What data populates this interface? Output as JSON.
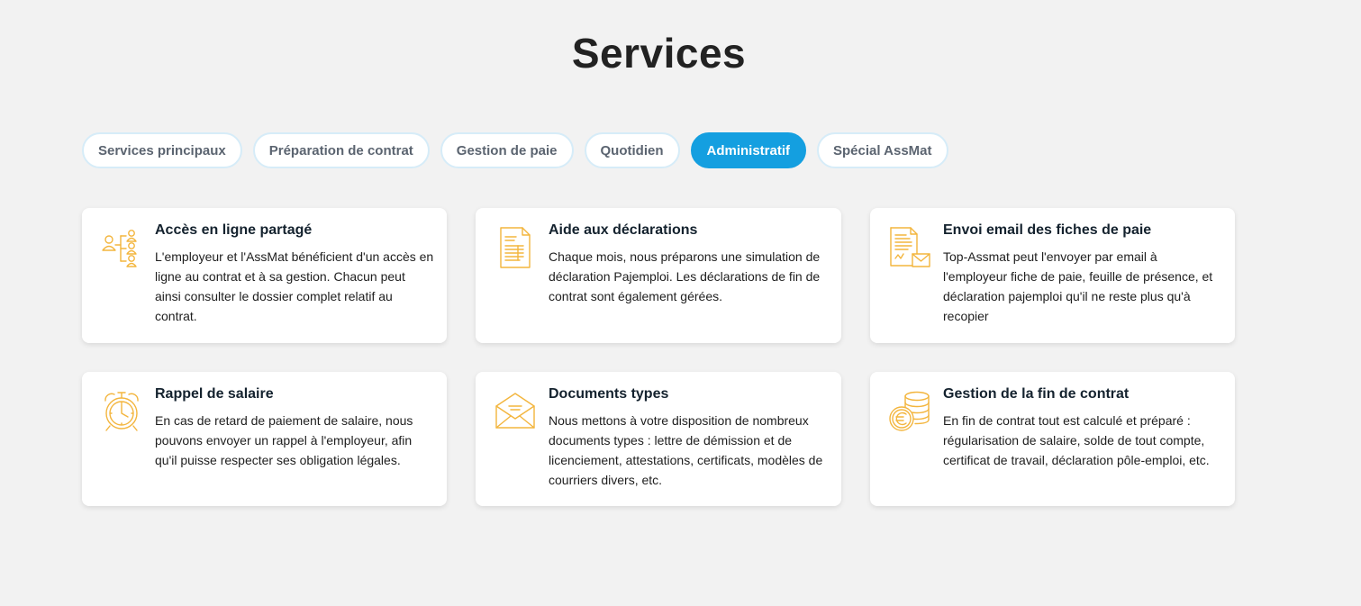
{
  "page": {
    "title": "Services"
  },
  "tabs": [
    {
      "label": "Services principaux",
      "active": false
    },
    {
      "label": "Préparation de contrat",
      "active": false
    },
    {
      "label": "Gestion de paie",
      "active": false
    },
    {
      "label": "Quotidien",
      "active": false
    },
    {
      "label": "Administratif",
      "active": true
    },
    {
      "label": "Spécial AssMat",
      "active": false
    }
  ],
  "colors": {
    "accent": "#149fe0",
    "icon": "#f3b53d",
    "background": "#f2f2f2"
  },
  "cards": [
    {
      "icon": "shared-access-icon",
      "title": "Accès en ligne partagé",
      "text": "L'employeur et l'AssMat bénéficient d'un accès en ligne au contrat et à sa gestion. Chacun peut ainsi consulter le dossier complet relatif au contrat."
    },
    {
      "icon": "declaration-document-icon",
      "title": "Aide aux déclarations",
      "text": "Chaque mois, nous préparons une simulation de déclaration Pajemploi. Les déclarations de fin de contrat sont également gérées."
    },
    {
      "icon": "document-email-icon",
      "title": "Envoi email des fiches de paie",
      "text": "Top-Assmat peut l'envoyer par email à l'employeur fiche de paie, feuille de présence, et déclaration pajemploi qu'il ne reste plus qu'à recopier"
    },
    {
      "icon": "alarm-clock-icon",
      "title": "Rappel de salaire",
      "text": "En cas de retard de paiement de salaire, nous pouvons envoyer un rappel à l'employeur, afin qu'il puisse respecter ses obligation légales."
    },
    {
      "icon": "envelope-icon",
      "title": "Documents types",
      "text": "Nous mettons à votre disposition de nombreux documents types : lettre de démission et de licenciement, attestations, certificats, modèles de courriers divers, etc."
    },
    {
      "icon": "euro-coins-icon",
      "title": "Gestion de la fin de contrat",
      "text": "En fin de contrat tout est calculé et préparé : régularisation de salaire, solde de tout compte, certificat de travail, déclaration pôle-emploi, etc."
    }
  ]
}
